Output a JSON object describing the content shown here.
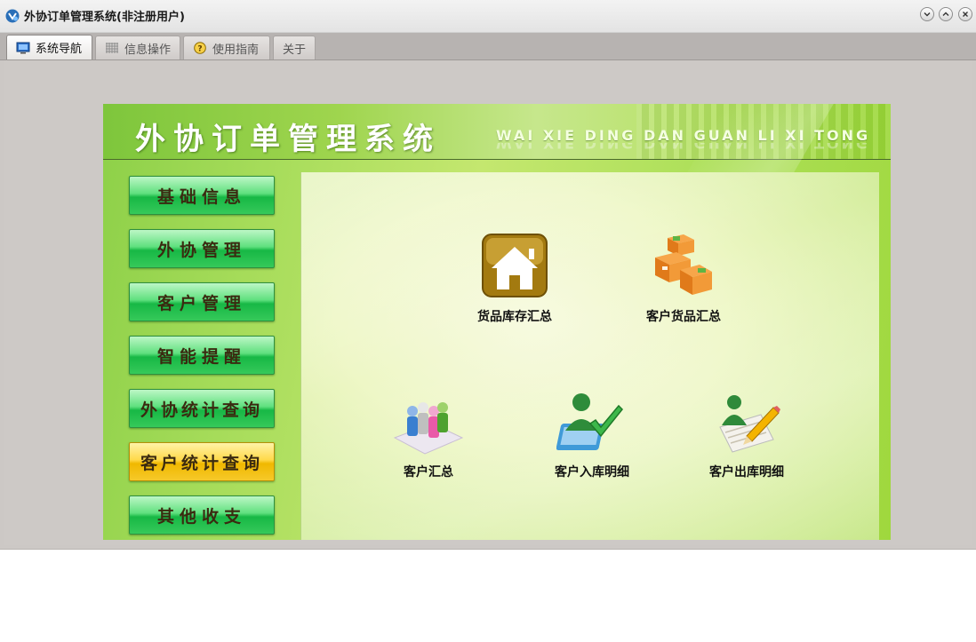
{
  "window": {
    "title": "外协订单管理系统(非注册用户)",
    "controls": [
      "minimize-icon",
      "maximize-icon",
      "close-icon"
    ]
  },
  "tabs": [
    {
      "label": "系统导航",
      "icon": "monitor-icon",
      "active": true
    },
    {
      "label": "信息操作",
      "icon": "grid-icon",
      "active": false
    },
    {
      "label": "使用指南",
      "icon": "help-icon",
      "active": false
    },
    {
      "label": "关于",
      "icon": "",
      "active": false
    }
  ],
  "banner": {
    "title": "外协订单管理系统",
    "subtitle": "WAI XIE DING DAN GUAN LI XI TONG"
  },
  "menu": [
    {
      "label": "基础信息",
      "active": false
    },
    {
      "label": "外协管理",
      "active": false
    },
    {
      "label": "客户管理",
      "active": false
    },
    {
      "label": "智能提醒",
      "active": false
    },
    {
      "label": "外协统计查询",
      "active": false
    },
    {
      "label": "客户统计查询",
      "active": true
    },
    {
      "label": "其他收支",
      "active": false
    }
  ],
  "shortcuts": [
    {
      "label": "货品库存汇总",
      "icon": "house-icon"
    },
    {
      "label": "客户货品汇总",
      "icon": "boxes-icon"
    },
    {
      "label": "客户汇总",
      "icon": "people-icon"
    },
    {
      "label": "客户入库明细",
      "icon": "user-check-icon"
    },
    {
      "label": "客户出库明细",
      "icon": "user-edit-icon"
    }
  ],
  "colors": {
    "menu_button": "#17b845",
    "menu_button_active": "#f0b800",
    "panel_green": "#9fd83d"
  }
}
